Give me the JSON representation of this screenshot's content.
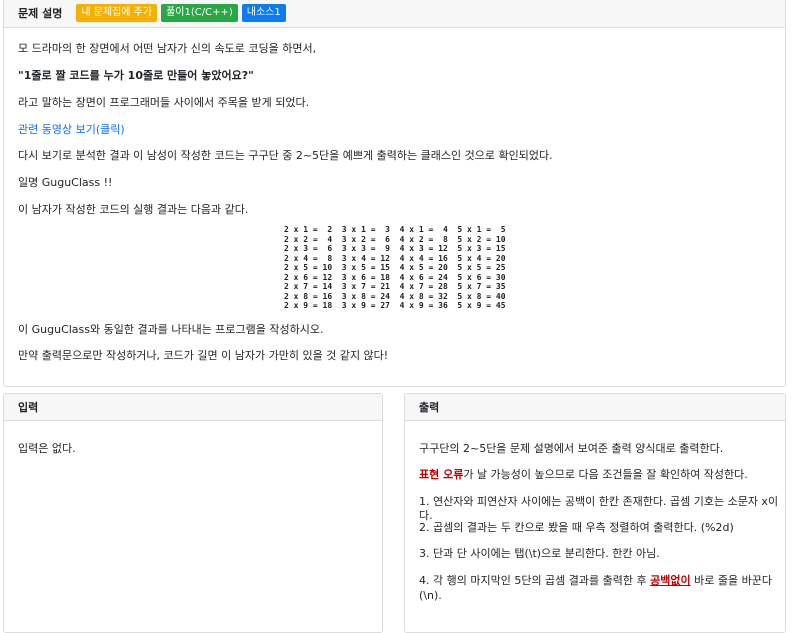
{
  "problem": {
    "title": "문제 설명",
    "buttons": {
      "add": "내 문제집에 추가",
      "solve": "풀이1(C/C++)",
      "source": "내소스1"
    },
    "lines": [
      "모 드라마의 한 장면에서 어떤 남자가 신의 속도로 코딩을 하면서,",
      "\"1줄로 짤 코드를 누가 10줄로 만들어 놓았어요?\"",
      "라고 말하는 장면이 프로그래머들 사이에서 주목을 받게 되었다.",
      "관련 동영상 보기(클릭)",
      "다시 보기로 분석한 결과 이 남성이 작성한 코드는 구구단 중 2~5단을 예쁘게 출력하는 클래스인 것으로 확인되었다.",
      "일명 GuguClass !!",
      "이 남자가 작성한 코드의 실행 결과는 다음과 같다.",
      "이 GuguClass와 동일한 결과를 나타내는 프로그램을 작성하시오.",
      "만약 출력문으로만 작성하거나, 코드가 길면 이 남자가 가만히 있을 것 같지 않다!"
    ],
    "table": "2 x 1 =  2  3 x 1 =  3  4 x 1 =  4  5 x 1 =  5\n2 x 2 =  4  3 x 2 =  6  4 x 2 =  8  5 x 2 = 10\n2 x 3 =  6  3 x 3 =  9  4 x 3 = 12  5 x 3 = 15\n2 x 4 =  8  3 x 4 = 12  4 x 4 = 16  5 x 4 = 20\n2 x 5 = 10  3 x 5 = 15  4 x 5 = 20  5 x 5 = 25\n2 x 6 = 12  3 x 6 = 18  4 x 6 = 24  5 x 6 = 30\n2 x 7 = 14  3 x 7 = 21  4 x 7 = 28  5 x 7 = 35\n2 x 8 = 16  3 x 8 = 24  4 x 8 = 32  5 x 8 = 40\n2 x 9 = 18  3 x 9 = 27  4 x 9 = 36  5 x 9 = 45"
  },
  "input": {
    "title": "입력",
    "text": "입력은 없다."
  },
  "output": {
    "title": "출력",
    "l1": "구구단의 2~5단을 문제 설명에서 보여준 출력 양식대로 출력한다.",
    "l2_red": "표현 오류",
    "l2_rest": "가 날 가능성이 높으므로 다음 조건들을 잘 확인하여 작성한다.",
    "l3": "1. 연산자와 피연산자 사이에는 공백이 한칸 존재한다. 곱셈 기호는 소문자 x이다.",
    "l4": "2. 곱셈의 결과는 두 칸으로 봤을 때 우측 정렬하여 출력한다. (%2d)",
    "l5": "3. 단과 단 사이에는 탭(\\t)으로 분리한다. 한칸 아님.",
    "l6_pre": "4. 각 행의 마지막인 5단의 곱셈 결과를 출력한 후 ",
    "l6_red": "공백없이",
    "l6_post": " 바로 줄을 바꾼다",
    "l6_cont": "(\\n)."
  }
}
